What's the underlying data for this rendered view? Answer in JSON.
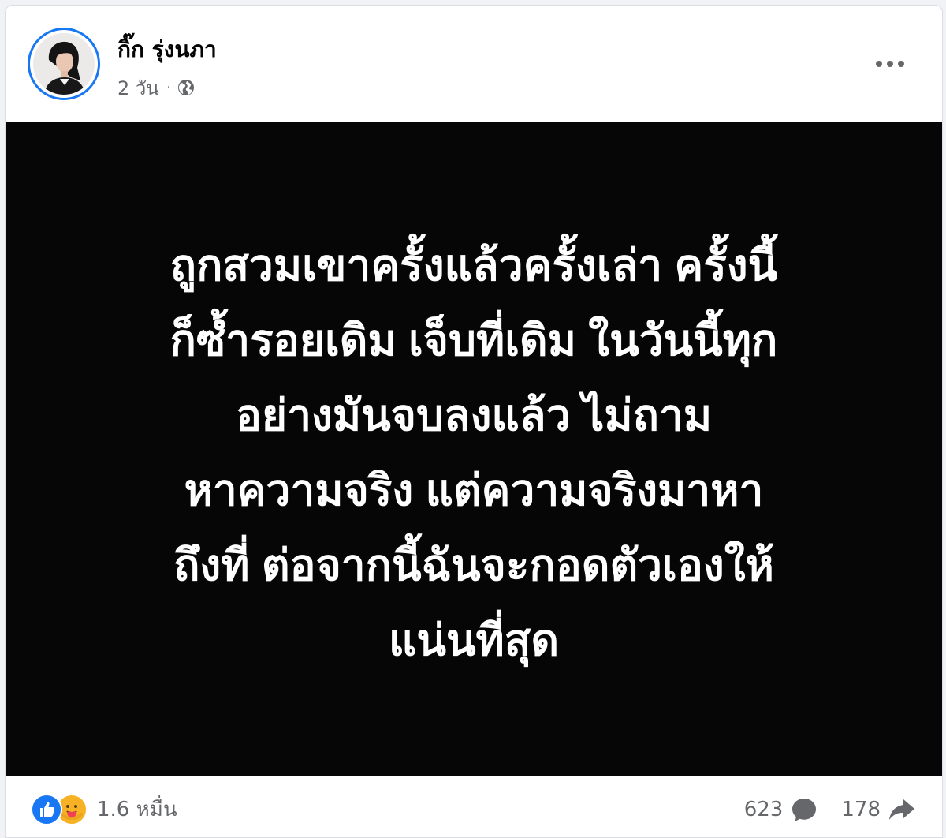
{
  "post": {
    "author_name": "กิ๊ก รุ่งนภา",
    "timestamp": "2 วัน",
    "separator": "·",
    "privacy_icon": "globe-icon",
    "more_icon": "more-options-icon",
    "body_text": "ถูกสวมเขาครั้งแล้วครั้งเล่า ครั้งนี้\nก็ซ้ำรอยเดิม เจ็บที่เดิม ในวันนี้ทุก\nอย่างมันจบลงแล้ว ไม่ถาม\nหาความจริง แต่ความจริงมาหา\nถึงที่ ต่อจากนี้ฉันจะกอดตัวเองให้\nแน่นที่สุด",
    "background_color": "#060606",
    "text_color": "#ffffff"
  },
  "footer": {
    "reaction_icons": [
      "like-icon",
      "care-icon"
    ],
    "reaction_count": "1.6 หมื่น",
    "comment_count": "623",
    "comment_icon": "comment-bubble-icon",
    "share_count": "178",
    "share_icon": "share-arrow-icon"
  },
  "colors": {
    "accent": "#1877f2",
    "secondary_text": "#65676b",
    "care": "#f7b125"
  }
}
